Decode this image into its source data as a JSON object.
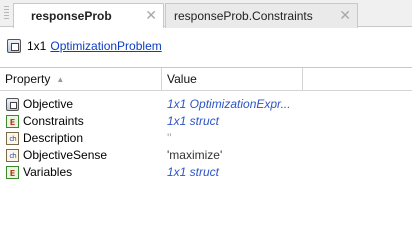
{
  "tabs": [
    {
      "label": "responseProb",
      "close": "✕",
      "active": true
    },
    {
      "label": "responseProb.Constraints",
      "close": "✕",
      "active": false
    }
  ],
  "summary": {
    "size": "1x1",
    "class_link": "OptimizationProblem"
  },
  "table": {
    "headers": {
      "property": "Property",
      "value": "Value"
    },
    "rows": [
      {
        "name": "Objective",
        "icon": "optimization-object-icon",
        "value": "1x1 OptimizationExpr..."
      },
      {
        "name": "Constraints",
        "icon": "struct-icon",
        "value": "1x1 struct"
      },
      {
        "name": "Description",
        "icon": "char-icon",
        "value": "''"
      },
      {
        "name": "ObjectiveSense",
        "icon": "char-icon",
        "value": "'maximize'"
      },
      {
        "name": "Variables",
        "icon": "struct-icon",
        "value": "1x1 struct"
      }
    ]
  }
}
